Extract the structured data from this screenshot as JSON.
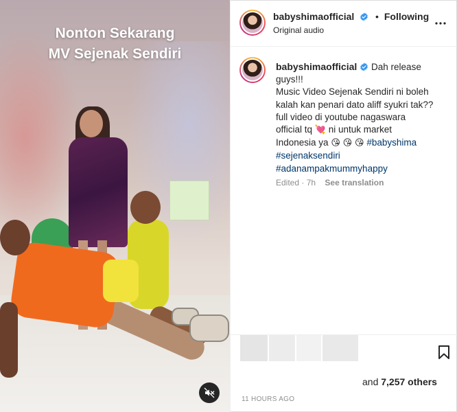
{
  "media": {
    "overlay_line1": "Nonton Sekarang",
    "overlay_line2": "MV Sejenak Sendiri",
    "mute_icon": "speaker-muted-icon"
  },
  "header": {
    "username": "babyshimaofficial",
    "follow_status": "Following",
    "audio": "Original audio",
    "more_icon": "more-horizontal-icon"
  },
  "caption": {
    "username": "babyshimaofficial",
    "lines": [
      "Dah release",
      "guys!!!",
      "Music Video Sejenak Sendiri ni boleh",
      "kalah kan penari dato aliff syukri tak??",
      "full video di youtube nagaswara",
      "official tq"
    ],
    "line_tail": "ni untuk market",
    "line_last": "Indonesia ya",
    "hashtags": [
      "#babyshima",
      "#sejenaksendiri",
      "#adanampakmummyhappy"
    ],
    "meta_edited": "Edited · 7h",
    "see_translation": "See translation"
  },
  "actions": {
    "likes_prefix": "and",
    "likes_count": "7,257 others",
    "time": "11 HOURS AGO"
  },
  "colors": {
    "text": "#262626",
    "secondary": "#8e8e8e",
    "link": "#00376b",
    "verified": "#3897f0"
  }
}
